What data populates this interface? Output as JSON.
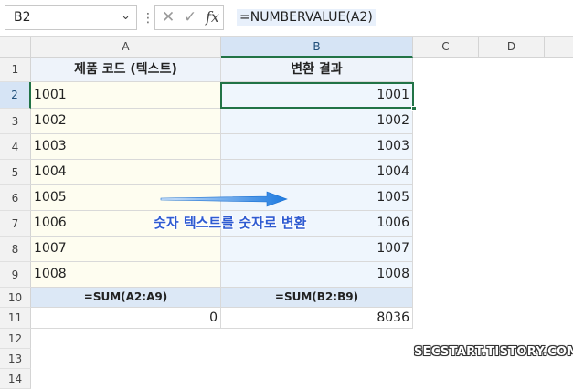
{
  "formula_bar": {
    "name_box": "B2",
    "cancel_symbol": "✕",
    "enter_symbol": "✓",
    "fx_label": "fx",
    "formula": "=NUMBERVALUE(A2)"
  },
  "columns": [
    "A",
    "B",
    "C",
    "D"
  ],
  "rows": [
    "1",
    "2",
    "3",
    "4",
    "5",
    "6",
    "7",
    "8",
    "9",
    "10",
    "11",
    "12",
    "13",
    "14"
  ],
  "table": {
    "header_a": "제품 코드 (텍스트)",
    "header_b": "변환 결과",
    "values_a": [
      "1001",
      "1002",
      "1003",
      "1004",
      "1005",
      "1006",
      "1007",
      "1008"
    ],
    "values_b": [
      "1001",
      "1002",
      "1003",
      "1004",
      "1005",
      "1006",
      "1007",
      "1008"
    ],
    "sum_label_a": "=SUM(A2:A9)",
    "sum_label_b": "=SUM(B2:B9)",
    "sum_value_a": "0",
    "sum_value_b": "8036"
  },
  "annotation": "숫자 텍스트를 숫자로 변환",
  "watermark": "SECSTART.TISTORY.COM",
  "colors": {
    "accent": "#217346",
    "arrow": "#1e7be0",
    "annotation_text": "#2f5bd1",
    "col_a_fill": "#fefdf0",
    "col_b_fill": "#eff6fd",
    "sum_fill": "#dce8f6"
  }
}
